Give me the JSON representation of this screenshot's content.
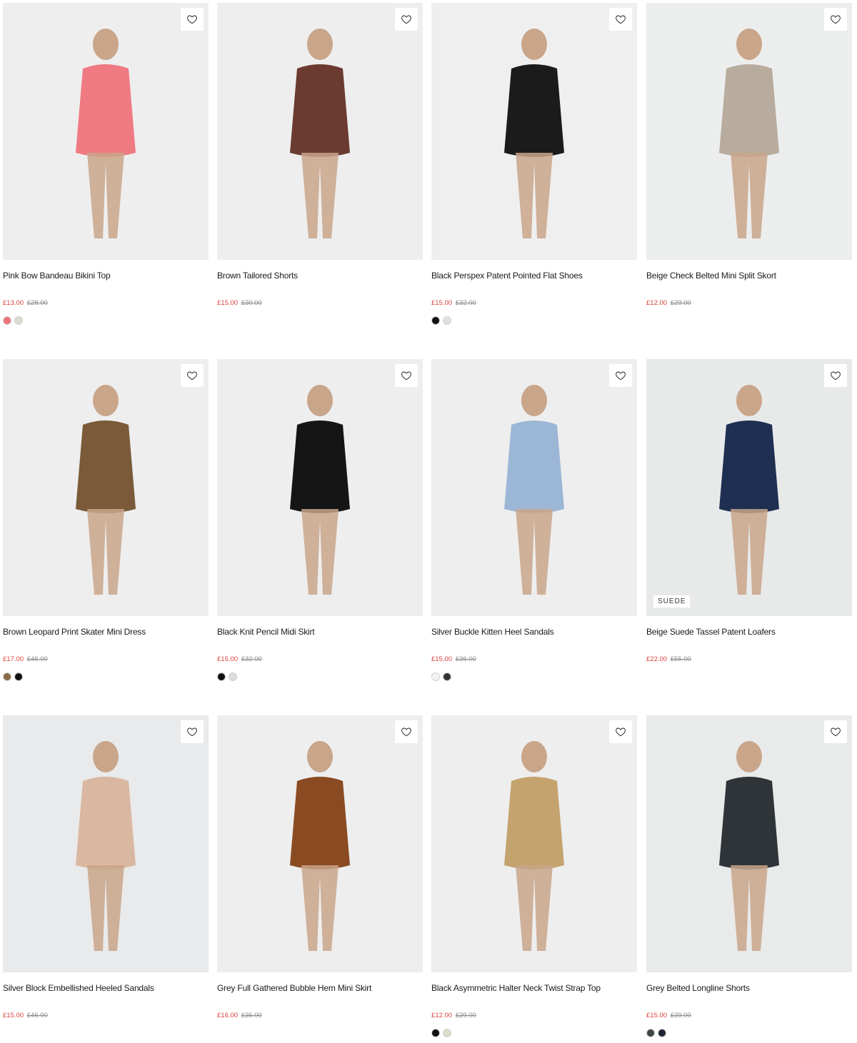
{
  "products": [
    {
      "name": "Pink Bow Bandeau Bikini Top",
      "price": "£13.00",
      "was": "£28.00",
      "swatches": [
        "#ee7379",
        "#dcdad3"
      ],
      "tag": "",
      "bg": "#eeeeee",
      "figure": "#f07a82"
    },
    {
      "name": "Brown Tailored Shorts",
      "price": "£15.00",
      "was": "£30.00",
      "swatches": [],
      "tag": "",
      "bg": "#eeeeee",
      "figure": "#6b3a30"
    },
    {
      "name": "Black Perspex Patent Pointed Flat Shoes",
      "price": "£15.00",
      "was": "£32.00",
      "swatches": [
        "#111111",
        "#e4dee0"
      ],
      "tag": "",
      "bg": "#efefef",
      "figure": "#1b1b1b"
    },
    {
      "name": "Beige Check Belted Mini Split Skort",
      "price": "£12.00",
      "was": "£29.00",
      "swatches": [],
      "tag": "",
      "bg": "#eceeee",
      "figure": "#b7ac9d"
    },
    {
      "name": "Brown Leopard Print Skater Mini Dress",
      "price": "£17.00",
      "was": "£46.00",
      "swatches": [
        "#8a6b47",
        "#111111"
      ],
      "tag": "",
      "bg": "#eeeeee",
      "figure": "#7a5a38"
    },
    {
      "name": "Black Knit Pencil Midi Skirt",
      "price": "£15.00",
      "was": "£32.00",
      "swatches": [
        "#111111",
        "#dcdcdc"
      ],
      "tag": "",
      "bg": "#eeeeee",
      "figure": "#151515"
    },
    {
      "name": "Silver Buckle Kitten Heel Sandals",
      "price": "£15.00",
      "was": "£36.00",
      "swatches": [
        "#f2f2f2",
        "#333333"
      ],
      "tag": "",
      "bg": "#eeeeee",
      "figure": "#9cb7d6"
    },
    {
      "name": "Beige Suede Tassel Patent Loafers",
      "price": "£22.00",
      "was": "£55.00",
      "swatches": [],
      "tag": "SUEDE",
      "bg": "#e8eaea",
      "figure": "#1f2f52"
    },
    {
      "name": "Silver Block Embellished Heeled Sandals",
      "price": "£15.00",
      "was": "£46.00",
      "swatches": [],
      "tag": "",
      "bg": "#e9eaeb",
      "figure": "#d9b7a1"
    },
    {
      "name": "Grey Full Gathered Bubble Hem Mini Skirt",
      "price": "£16.00",
      "was": "£36.00",
      "swatches": [],
      "tag": "",
      "bg": "#eeeeee",
      "figure": "#8a4b22"
    },
    {
      "name": "Black Asymmetric Halter Neck Twist Strap Top",
      "price": "£12.00",
      "was": "£29.00",
      "swatches": [
        "#111111",
        "#dcdcc9"
      ],
      "tag": "",
      "bg": "#eeeeee",
      "figure": "#c4a36e"
    },
    {
      "name": "Grey Belted Longline Shorts",
      "price": "£15.00",
      "was": "£39.00",
      "swatches": [
        "#3d4446",
        "#1e2433"
      ],
      "tag": "",
      "bg": "#e9eaea",
      "figure": "#2f3438"
    }
  ],
  "icons": {
    "wishlist": "heart-outline-icon"
  }
}
